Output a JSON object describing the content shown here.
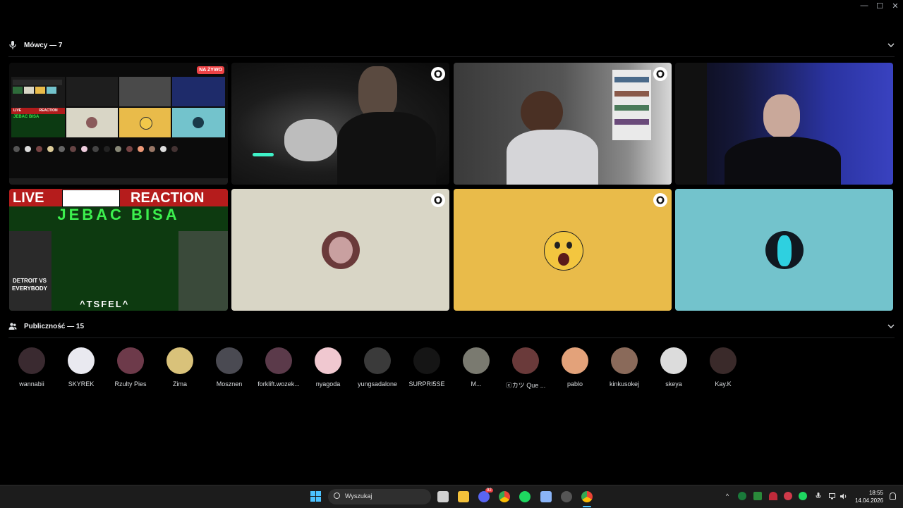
{
  "window": {
    "minimize": "—",
    "maximize": "☐",
    "close": "✕"
  },
  "speakers": {
    "header": "Mówcy — 7"
  },
  "stage": {
    "screenshare_badge": "NA ŻYWO",
    "stream_title_left": "LIVE",
    "stream_title_right": "REACTION",
    "stream_banner": "JEBAC BISA",
    "stream_footer": "^TSFEL^",
    "stream_side": "DETROIT VS EVERYBODY",
    "mini_live": "LIVE",
    "mini_reaction": "REACTION",
    "mini_banner": "JEBAC BISA"
  },
  "audience": {
    "header": "Publiczność — 15",
    "members": [
      {
        "name": "wannabii",
        "color": "#3a2a30"
      },
      {
        "name": "SKYREK",
        "color": "#e9e9f0"
      },
      {
        "name": "Rzulty Pies",
        "color": "#6d3a4a"
      },
      {
        "name": "Zima",
        "color": "#d9c27a"
      },
      {
        "name": "Mosznen",
        "color": "#4a4a52"
      },
      {
        "name": "forklift.wozek...",
        "color": "#5b3a4a"
      },
      {
        "name": "nyagoda",
        "color": "#f0c8d0"
      },
      {
        "name": "yungsadalone",
        "color": "#3a3a3a"
      },
      {
        "name": "SURPRI5SE",
        "color": "#151515"
      },
      {
        "name": "M...",
        "color": "#7a7a70"
      },
      {
        "name": "ⓔカツ Que ...",
        "color": "#6a3a3a"
      },
      {
        "name": "pablo",
        "color": "#e3a27a"
      },
      {
        "name": "kinkusokej",
        "color": "#8a6a5a"
      },
      {
        "name": "skeya",
        "color": "#dcdcdc"
      },
      {
        "name": "Kay.K",
        "color": "#3a2a2a"
      }
    ]
  },
  "taskbar": {
    "search_placeholder": "Wyszukaj",
    "time": "18:55",
    "date": "14.04.2026",
    "discord_badge": "92"
  },
  "colors": {
    "tile_beige": "#d9d6c6",
    "tile_yellow": "#e9bb4a",
    "tile_teal": "#73c3cc"
  }
}
